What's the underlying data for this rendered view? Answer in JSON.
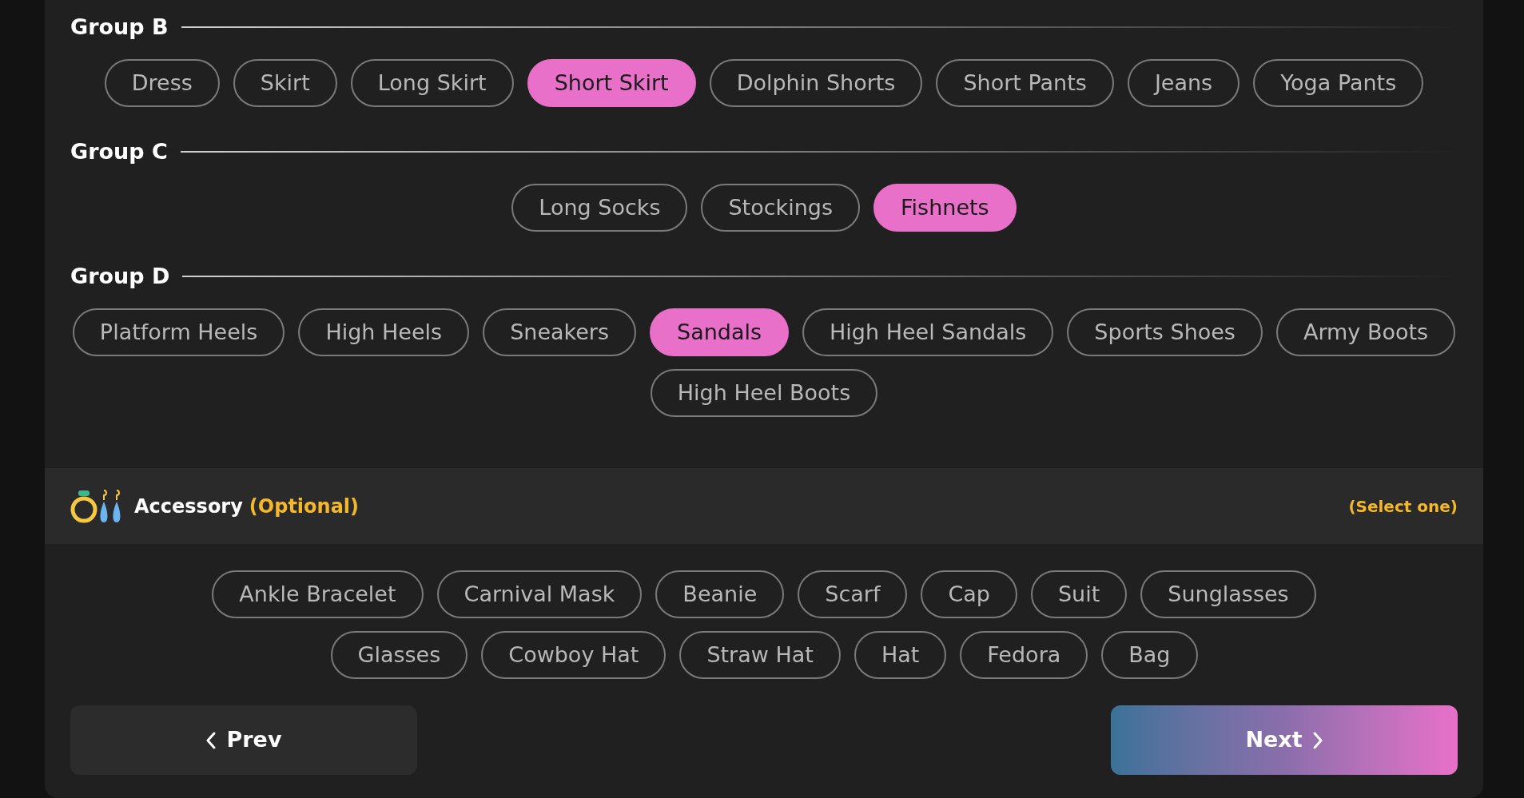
{
  "groups": [
    {
      "title": "Group B",
      "options": [
        {
          "label": "Dress",
          "selected": false
        },
        {
          "label": "Skirt",
          "selected": false
        },
        {
          "label": "Long Skirt",
          "selected": false
        },
        {
          "label": "Short Skirt",
          "selected": true
        },
        {
          "label": "Dolphin Shorts",
          "selected": false
        },
        {
          "label": "Short Pants",
          "selected": false
        },
        {
          "label": "Jeans",
          "selected": false
        },
        {
          "label": "Yoga Pants",
          "selected": false
        }
      ]
    },
    {
      "title": "Group C",
      "options": [
        {
          "label": "Long Socks",
          "selected": false
        },
        {
          "label": "Stockings",
          "selected": false
        },
        {
          "label": "Fishnets",
          "selected": true
        }
      ]
    },
    {
      "title": "Group D",
      "options": [
        {
          "label": "Platform Heels",
          "selected": false
        },
        {
          "label": "High Heels",
          "selected": false
        },
        {
          "label": "Sneakers",
          "selected": false
        },
        {
          "label": "Sandals",
          "selected": true
        },
        {
          "label": "High Heel Sandals",
          "selected": false
        },
        {
          "label": "Sports Shoes",
          "selected": false
        },
        {
          "label": "Army Boots",
          "selected": false
        },
        {
          "label": "High Heel Boots",
          "selected": false
        }
      ]
    }
  ],
  "accessory": {
    "title": "Accessory",
    "optional": "(Optional)",
    "hint": "(Select one)",
    "options": [
      {
        "label": "Ankle Bracelet",
        "selected": false
      },
      {
        "label": "Carnival Mask",
        "selected": false
      },
      {
        "label": "Beanie",
        "selected": false
      },
      {
        "label": "Scarf",
        "selected": false
      },
      {
        "label": "Cap",
        "selected": false
      },
      {
        "label": "Suit",
        "selected": false
      },
      {
        "label": "Sunglasses",
        "selected": false
      },
      {
        "label": "Glasses",
        "selected": false
      },
      {
        "label": "Cowboy Hat",
        "selected": false
      },
      {
        "label": "Straw Hat",
        "selected": false
      },
      {
        "label": "Hat",
        "selected": false
      },
      {
        "label": "Fedora",
        "selected": false
      },
      {
        "label": "Bag",
        "selected": false
      }
    ]
  },
  "nav": {
    "prev": "Prev",
    "next": "Next"
  }
}
